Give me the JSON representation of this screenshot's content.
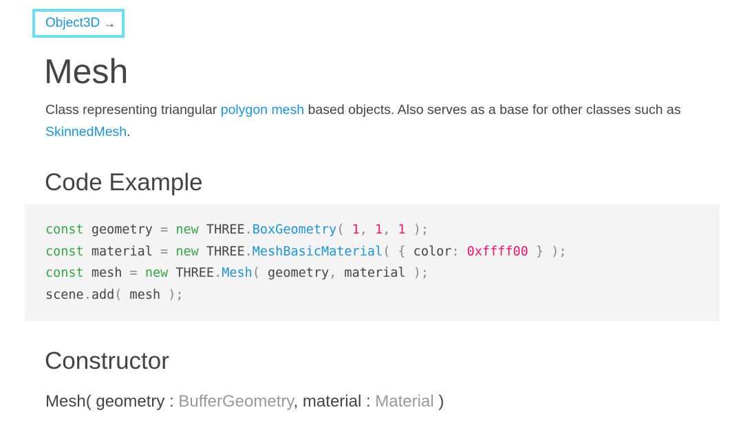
{
  "breadcrumb": {
    "parent_label": "Object3D",
    "arrow": "→"
  },
  "page": {
    "title": "Mesh"
  },
  "description": {
    "part1": "Class representing triangular ",
    "link1": "polygon mesh",
    "part2": " based objects. Also serves as a base for other classes such as ",
    "link2": "SkinnedMesh",
    "part3": "."
  },
  "sections": {
    "code_example_heading": "Code Example",
    "constructor_heading": "Constructor"
  },
  "code": {
    "line1": {
      "kw1": "const",
      "t1": " geometry ",
      "p1": "=",
      "t2": " ",
      "kw2": "new",
      "t3": " THREE",
      "p2": ".",
      "cls": "BoxGeometry",
      "p3": "(",
      "t4": " ",
      "n1": "1",
      "p4": ",",
      "t5": " ",
      "n2": "1",
      "p5": ",",
      "t6": " ",
      "n3": "1",
      "t7": " ",
      "p6": ");"
    },
    "line2": {
      "kw1": "const",
      "t1": " material ",
      "p1": "=",
      "t2": " ",
      "kw2": "new",
      "t3": " THREE",
      "p2": ".",
      "cls": "MeshBasicMaterial",
      "p3": "(",
      "t4": " ",
      "p4": "{",
      "t5": " color",
      "p5": ":",
      "t6": " ",
      "n1": "0xffff00",
      "t7": " ",
      "p6": "}",
      "t8": " ",
      "p7": ");"
    },
    "line3": {
      "kw1": "const",
      "t1": " mesh ",
      "p1": "=",
      "t2": " ",
      "kw2": "new",
      "t3": " THREE",
      "p2": ".",
      "cls": "Mesh",
      "p3": "(",
      "t4": " geometry",
      "p4": ",",
      "t5": " material ",
      "p5": ");"
    },
    "line4": {
      "t1": "scene",
      "p1": ".",
      "t2": "add",
      "p2": "(",
      "t3": " mesh ",
      "p3": ");"
    }
  },
  "constructor": {
    "name": "Mesh(",
    "param1": " geometry : ",
    "type1": "BufferGeometry",
    "sep": ", material : ",
    "type2": "Material",
    "close": " )"
  },
  "colors": {
    "link": "#2194ce",
    "keyword": "#3aa348",
    "number": "#e5176f",
    "focus_outline": "#67e0f0",
    "code_background": "#f4f4f4"
  }
}
